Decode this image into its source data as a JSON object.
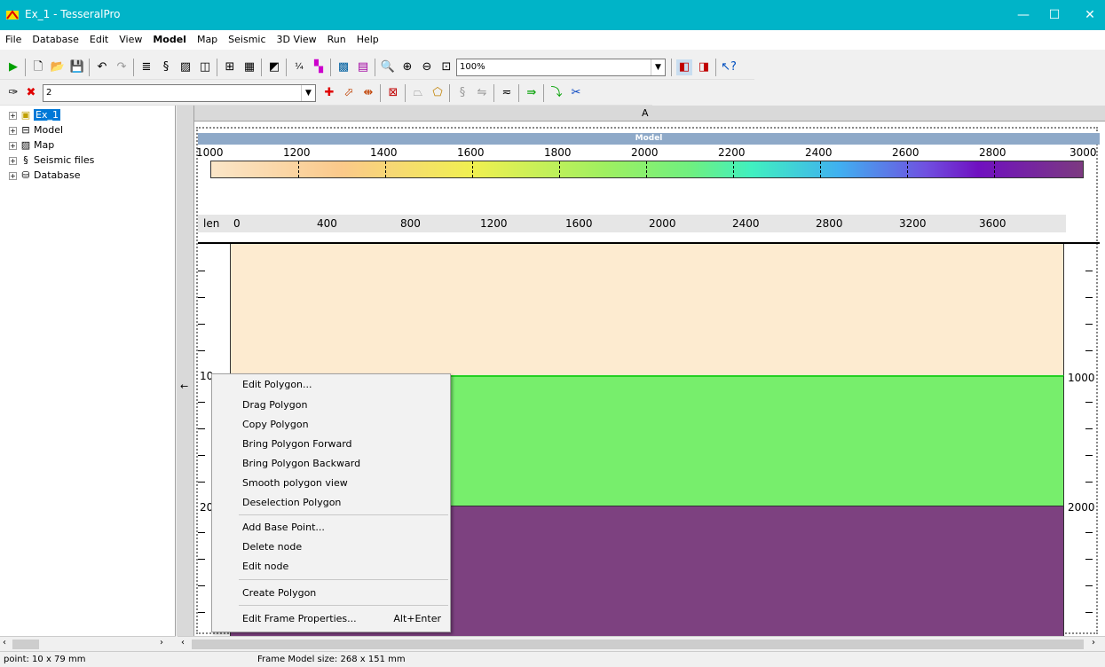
{
  "window": {
    "title": "Ex_1 - TesseralPro",
    "minimize": "—",
    "maximize": "☐",
    "close": "✕"
  },
  "menu": [
    "File",
    "Database",
    "Edit",
    "View",
    "Model",
    "Map",
    "Seismic",
    "3D View",
    "Run",
    "Help"
  ],
  "toolbar": {
    "zoom_value": "100%",
    "layer_value": "2"
  },
  "tree": {
    "items": [
      {
        "label": "Ex_1",
        "icon": "project-icon"
      },
      {
        "label": "Model",
        "icon": "model-icon"
      },
      {
        "label": "Map",
        "icon": "map-icon"
      },
      {
        "label": "Seismic files",
        "icon": "seismic-icon"
      },
      {
        "label": "Database",
        "icon": "database-icon"
      }
    ]
  },
  "grid": {
    "column_label": "A"
  },
  "model": {
    "header": "Model",
    "scale_ticks": [
      "1000",
      "1200",
      "1400",
      "1600",
      "1800",
      "2000",
      "2200",
      "2400",
      "2600",
      "2800",
      "3000"
    ],
    "len_label": "len",
    "len_ticks": [
      "0",
      "400",
      "800",
      "1200",
      "1600",
      "2000",
      "2400",
      "2800",
      "3200",
      "3600"
    ],
    "left_depth_1": "10",
    "left_depth_2": "20",
    "right_depth_1": "1000",
    "right_depth_2": "2000",
    "layer_colors": [
      "#fdebd0",
      "#77ee6c",
      "#7d4180"
    ]
  },
  "context_menu": {
    "items": [
      "Edit Polygon...",
      "Drag Polygon",
      "Copy Polygon",
      "Bring Polygon Forward",
      "Bring Polygon Backward",
      "Smooth polygon view",
      "Deselection Polygon",
      "Add Base Point...",
      "Delete node",
      "Edit node",
      "Create Polygon",
      "Edit Frame Properties..."
    ],
    "shortcut": "Alt+Enter"
  },
  "status": {
    "point": "point: 10 x 79 mm",
    "frame": "Frame Model size: 268 x 151 mm"
  }
}
